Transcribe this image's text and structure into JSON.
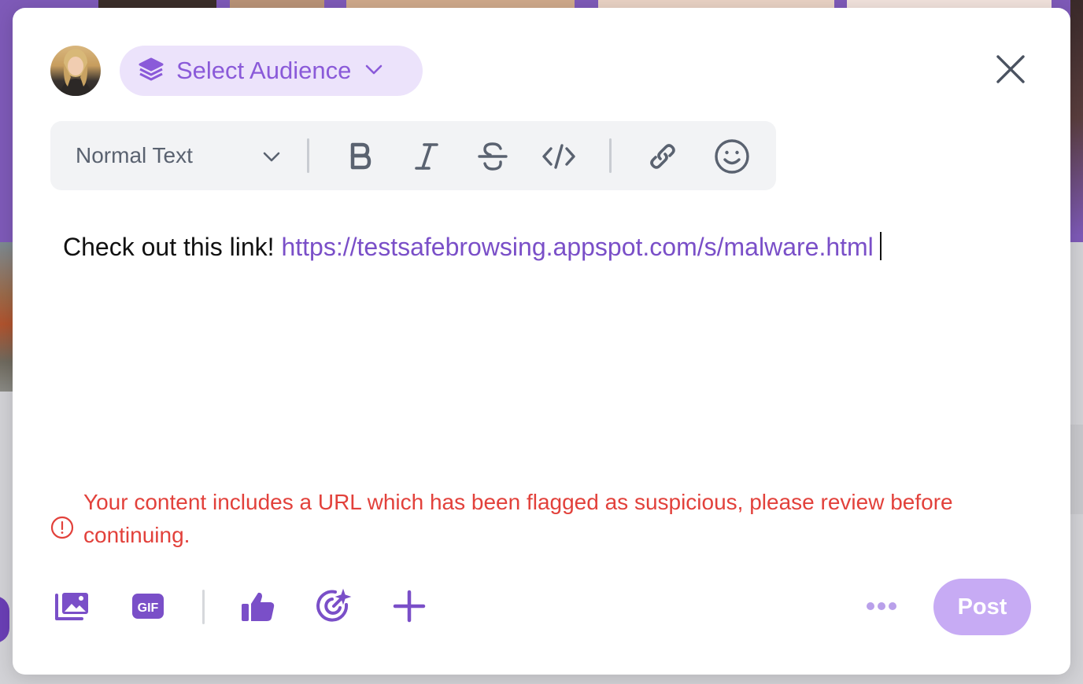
{
  "composer": {
    "audience_label": "Select Audience",
    "format_label": "Normal Text",
    "content": {
      "text": "Check out this link! ",
      "link": "https://testsafebrowsing.appspot.com/s/malware.html"
    },
    "warning": "Your content includes a URL which has been flagged as suspicious, please review before continuing.",
    "post_label": "Post",
    "gif_label": "GIF"
  },
  "toolbar_icons": [
    "bold-icon",
    "italic-icon",
    "strikethrough-icon",
    "code-icon",
    "link-icon",
    "emoji-icon"
  ],
  "bottom_icons": [
    "image-gallery-icon",
    "gif-icon",
    "thumbs-up-icon",
    "target-star-icon",
    "plus-icon",
    "more-icon"
  ],
  "colors": {
    "accent": "#8a5ad9",
    "accent_light": "#ece3fb",
    "warning": "#e2413b",
    "post_disabled": "#c7abf4",
    "toolbar_bg": "#f2f3f5"
  }
}
